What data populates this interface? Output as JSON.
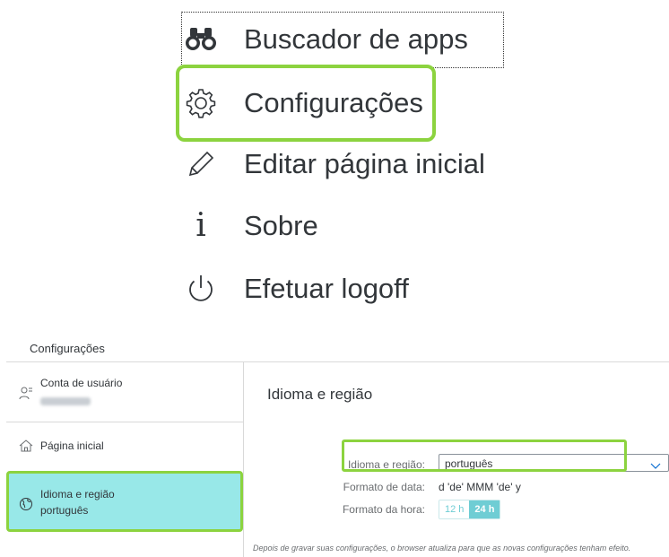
{
  "menu": {
    "items": [
      {
        "label": "Buscador de apps",
        "icon": "binoculars-icon"
      },
      {
        "label": "Configurações",
        "icon": "gear-icon"
      },
      {
        "label": "Editar página inicial",
        "icon": "pencil-icon"
      },
      {
        "label": "Sobre",
        "icon": "info-icon"
      },
      {
        "label": "Efetuar logoff",
        "icon": "power-icon"
      }
    ],
    "about_glyph": "i"
  },
  "settings": {
    "title": "Configurações",
    "sidebar": {
      "items": [
        {
          "title": "Conta de usuário",
          "icon": "user-icon"
        },
        {
          "title": "Página inicial",
          "icon": "home-icon"
        },
        {
          "title": "Idioma e região",
          "subtitle": "português",
          "icon": "globe-icon"
        }
      ]
    },
    "content": {
      "title": "Idioma e região",
      "language_label": "Idioma e região:",
      "language_value": "português",
      "date_format_label": "Formato de data:",
      "date_format_value": "d 'de' MMM 'de' y",
      "time_format_label": "Formato da hora:",
      "time_options": [
        "12 h",
        "24 h"
      ],
      "time_selected": "24 h",
      "footer_note": "Depois de gravar suas configurações, o browser atualiza para que as novas configurações tenham efeito."
    }
  },
  "colors": {
    "highlight": "#8cd33f",
    "selected_bg": "#98e8e8",
    "accent": "#6fcdd4",
    "text": "#32363a"
  }
}
